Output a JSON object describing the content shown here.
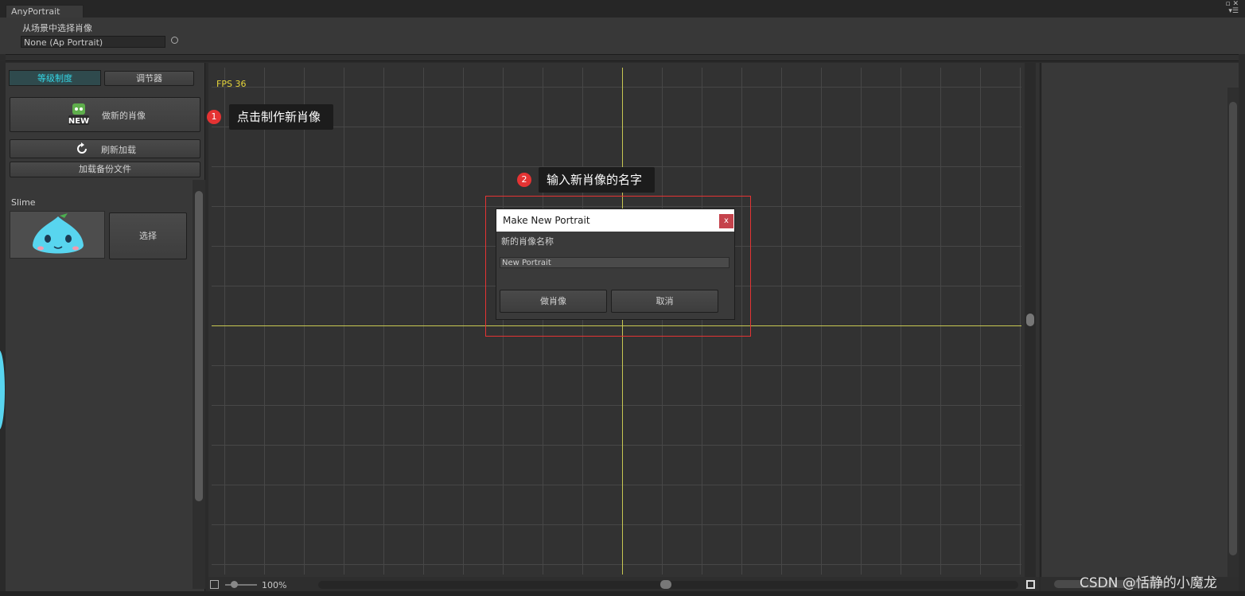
{
  "window": {
    "tab_title": "AnyPortrait",
    "controls": "▫ ✕\n▾☰"
  },
  "header": {
    "scene_label": "从场景中选择肖像",
    "portrait_field_value": "None (Ap Portrait)"
  },
  "left_panel": {
    "tabs": [
      {
        "label": "等级制度",
        "active": true
      },
      {
        "label": "调节器",
        "active": false
      }
    ],
    "new_portrait_button": "做新的肖像",
    "new_icon_text": "NEW",
    "reload_button": "刷新加载",
    "backup_button": "加载备份文件",
    "portrait_item": {
      "name": "Slime",
      "select_button": "选择"
    }
  },
  "viewport": {
    "fps_text": "FPS 36",
    "zoom_text": "100%",
    "grid_color": "#474747",
    "axis_color": "#c8c852"
  },
  "annotations": {
    "step1_number": "1",
    "step1_text": "点击制作新肖像",
    "step2_number": "2",
    "step2_text": "输入新肖像的名字",
    "highlight_color": "#e53333"
  },
  "dialog": {
    "title": "Make New Portrait",
    "close_label": "x",
    "name_label": "新的肖像名称",
    "name_value": "New Portrait",
    "ok_button": "做肖像",
    "cancel_button": "取消"
  },
  "watermark": "CSDN @恬静的小魔龙",
  "colors": {
    "active_tab_text": "#34d7e6",
    "fps_text": "#e6d53a",
    "close_button": "#c5434c"
  }
}
